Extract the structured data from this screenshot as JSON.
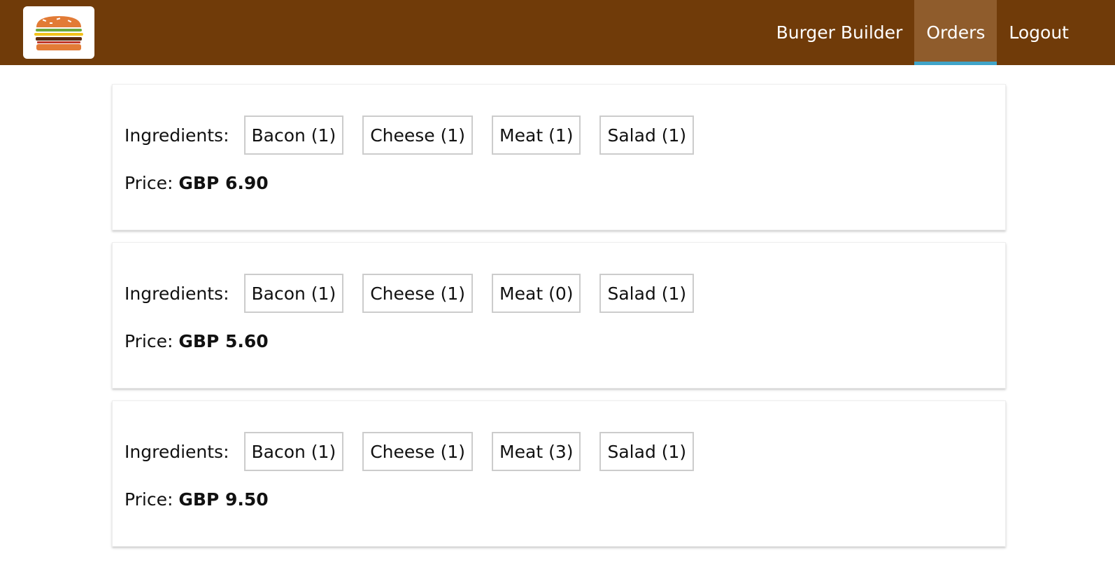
{
  "header": {
    "logo_icon": "burger-logo-icon",
    "nav": [
      {
        "label": "Burger Builder",
        "active": false
      },
      {
        "label": "Orders",
        "active": true
      },
      {
        "label": "Logout",
        "active": false
      }
    ]
  },
  "colors": {
    "toolbar": "#703B09",
    "active_nav": "#8F5C2C",
    "active_underline": "#40A4C8"
  },
  "orders": [
    {
      "ingredients_label": "Ingredients:",
      "ingredients": [
        "Bacon (1)",
        "Cheese (1)",
        "Meat (1)",
        "Salad (1)"
      ],
      "price_label": "Price:",
      "price": "GBP 6.90"
    },
    {
      "ingredients_label": "Ingredients:",
      "ingredients": [
        "Bacon (1)",
        "Cheese (1)",
        "Meat (0)",
        "Salad (1)"
      ],
      "price_label": "Price:",
      "price": "GBP 5.60"
    },
    {
      "ingredients_label": "Ingredients:",
      "ingredients": [
        "Bacon (1)",
        "Cheese (1)",
        "Meat (3)",
        "Salad (1)"
      ],
      "price_label": "Price:",
      "price": "GBP 9.50"
    }
  ]
}
